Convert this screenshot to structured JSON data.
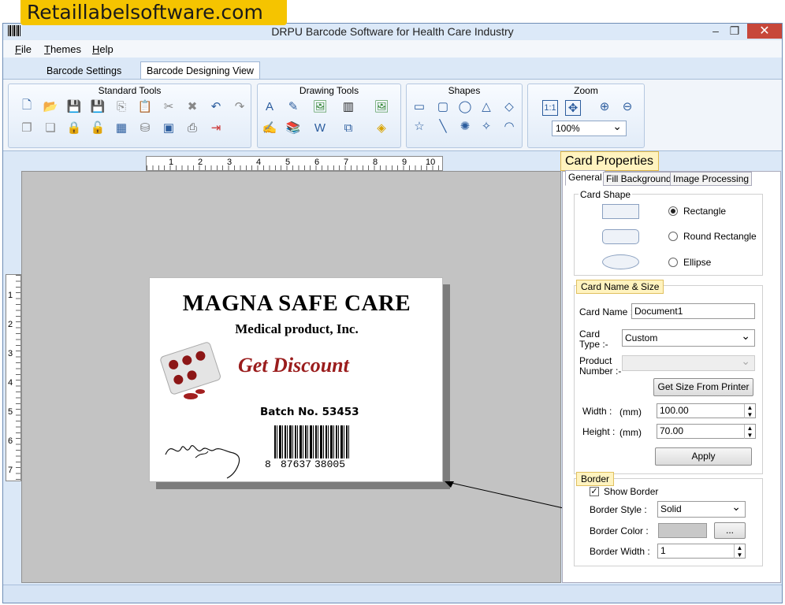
{
  "brand_banner": "Retaillabelsoftware.com",
  "window": {
    "title": "DRPU Barcode Software for Health Care Industry",
    "controls": {
      "minimize": "–",
      "restore": "❐",
      "close": "✕"
    }
  },
  "menu": [
    {
      "label": "File"
    },
    {
      "label": "Themes"
    },
    {
      "label": "Help"
    }
  ],
  "tabs": [
    {
      "label": "Barcode Settings"
    },
    {
      "label": "Barcode Designing View"
    }
  ],
  "ribbon": {
    "standard_tools": {
      "title": "Standard Tools"
    },
    "drawing_tools": {
      "title": "Drawing Tools"
    },
    "shapes": {
      "title": "Shapes"
    },
    "zoom": {
      "title": "Zoom",
      "value": "100%"
    }
  },
  "ruler": {
    "h": [
      "1",
      "2",
      "3",
      "4",
      "5",
      "6",
      "7",
      "8",
      "9",
      "10"
    ],
    "v": [
      "1",
      "2",
      "3",
      "4",
      "5",
      "6",
      "7"
    ]
  },
  "card": {
    "title": "MAGNA SAFE CARE",
    "subtitle": "Medical product, Inc.",
    "discount": "Get Discount",
    "batch": "Batch No. 53453",
    "barcode_left": "8",
    "barcode_mid": "87637",
    "barcode_right": "38005",
    "signature": "Will Wilson"
  },
  "properties": {
    "heading": "Card Properties",
    "tabs": [
      "General",
      "Fill Background",
      "Image Processing"
    ],
    "card_shape": {
      "legend": "Card Shape",
      "options": [
        "Rectangle",
        "Round Rectangle",
        "Ellipse"
      ],
      "selected": "Rectangle"
    },
    "name_size": {
      "legend": "Card  Name & Size",
      "card_name_label": "Card Name :",
      "card_name_value": "Document1",
      "card_type_label_1": "Card",
      "card_type_label_2": "Type :-",
      "card_type_value": "Custom",
      "product_label_1": "Product",
      "product_label_2": "Number :-",
      "get_size_button": "Get Size From Printer",
      "width_label": "Width :",
      "width_unit": "(mm)",
      "width_value": "100.00",
      "height_label": "Height :",
      "height_unit": "(mm)",
      "height_value": "70.00",
      "apply_button": "Apply"
    },
    "border": {
      "legend": "Border",
      "show_border": "Show Border",
      "show_border_checked": "✓",
      "style_label": "Border Style :",
      "style_value": "Solid",
      "color_label": "Border Color :",
      "color_value": "#c8c8c8",
      "color_button": "...",
      "width_label": "Border Width :",
      "width_value": "1"
    }
  }
}
